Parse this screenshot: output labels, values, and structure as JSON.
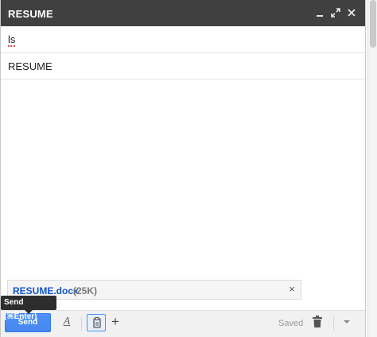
{
  "window": {
    "title": "RESUME",
    "minimize_icon": "minimize-icon",
    "popout_icon": "expand-icon",
    "close_icon": "close-icon"
  },
  "fields": {
    "to_value": "ls",
    "subject_value": "RESUME"
  },
  "attachment": {
    "filename": "RESUME.docx",
    "size": "(25K)",
    "remove_label": "×"
  },
  "tooltip": {
    "text": "Send (⌘Enter)"
  },
  "toolbar": {
    "send_label": "Send",
    "format_label": "A",
    "more_label": "+",
    "status": "Saved"
  },
  "colors": {
    "title_bar": "#404040",
    "send_button": "#4285f4",
    "attachment_link": "#1155cc"
  }
}
